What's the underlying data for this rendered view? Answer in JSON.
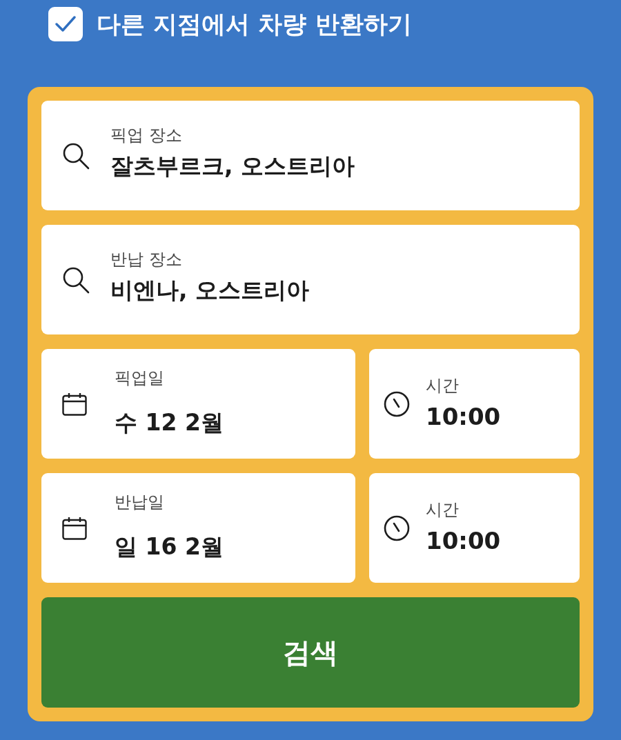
{
  "return_elsewhere": {
    "label": "다른 지점에서 차량 반환하기",
    "checked": true
  },
  "form": {
    "locations": [
      {
        "label": "픽업 장소",
        "value": "잘츠부르크, 오스트리아"
      },
      {
        "label": "반납 장소",
        "value": "비엔나, 오스트리아"
      }
    ],
    "schedule": [
      {
        "date": {
          "label": "픽업일",
          "value": "수 12 2월"
        },
        "time": {
          "label": "시간",
          "value": "10:00"
        }
      },
      {
        "date": {
          "label": "반납일",
          "value": "일 16 2월"
        },
        "time": {
          "label": "시간",
          "value": "10:00"
        }
      }
    ],
    "search_button": "검색"
  }
}
